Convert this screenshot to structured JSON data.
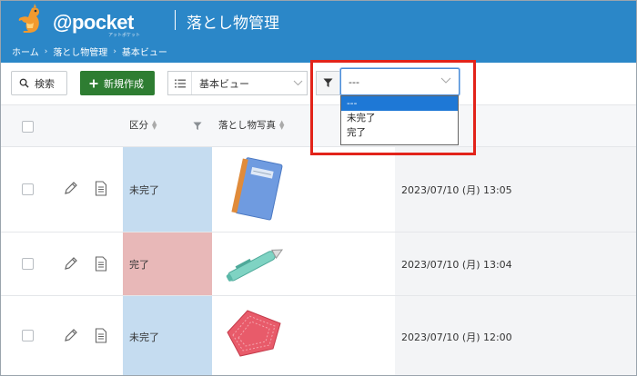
{
  "header": {
    "logo_text": "@pocket",
    "logo_sub": "アットポケット",
    "title": "落とし物管理",
    "breadcrumb": [
      "ホーム",
      "落とし物管理",
      "基本ビュー"
    ],
    "background": "#2b87c8"
  },
  "toolbar": {
    "search_label": "検索",
    "new_label": "新規作成",
    "view_label": "基本ビュー",
    "filter_value": "---",
    "filter_options": [
      "---",
      "未完了",
      "完了"
    ],
    "filter_selected_index": 0
  },
  "table": {
    "columns": {
      "category": "区分",
      "photo": "落とし物写真"
    },
    "rows": [
      {
        "category": "未完了",
        "category_color": "#c5dcf0",
        "photo": "notebook",
        "date": "2023/07/10 (月) 13:05"
      },
      {
        "category": "完了",
        "category_color": "#e8b8b8",
        "photo": "pen",
        "date": "2023/07/10 (月) 13:04"
      },
      {
        "category": "未完了",
        "category_color": "#c5dcf0",
        "photo": "handkerchief",
        "date": "2023/07/10 (月) 12:00"
      }
    ]
  },
  "icons": [
    "kangaroo-logo-icon",
    "search-icon",
    "plus-icon",
    "list-icon",
    "chevron-down-icon",
    "filter-icon",
    "pencil-icon",
    "document-icon"
  ],
  "colors": {
    "accent_green": "#2e7d32",
    "highlight_red": "#e2231a",
    "selected_blue": "#1e78d6"
  }
}
